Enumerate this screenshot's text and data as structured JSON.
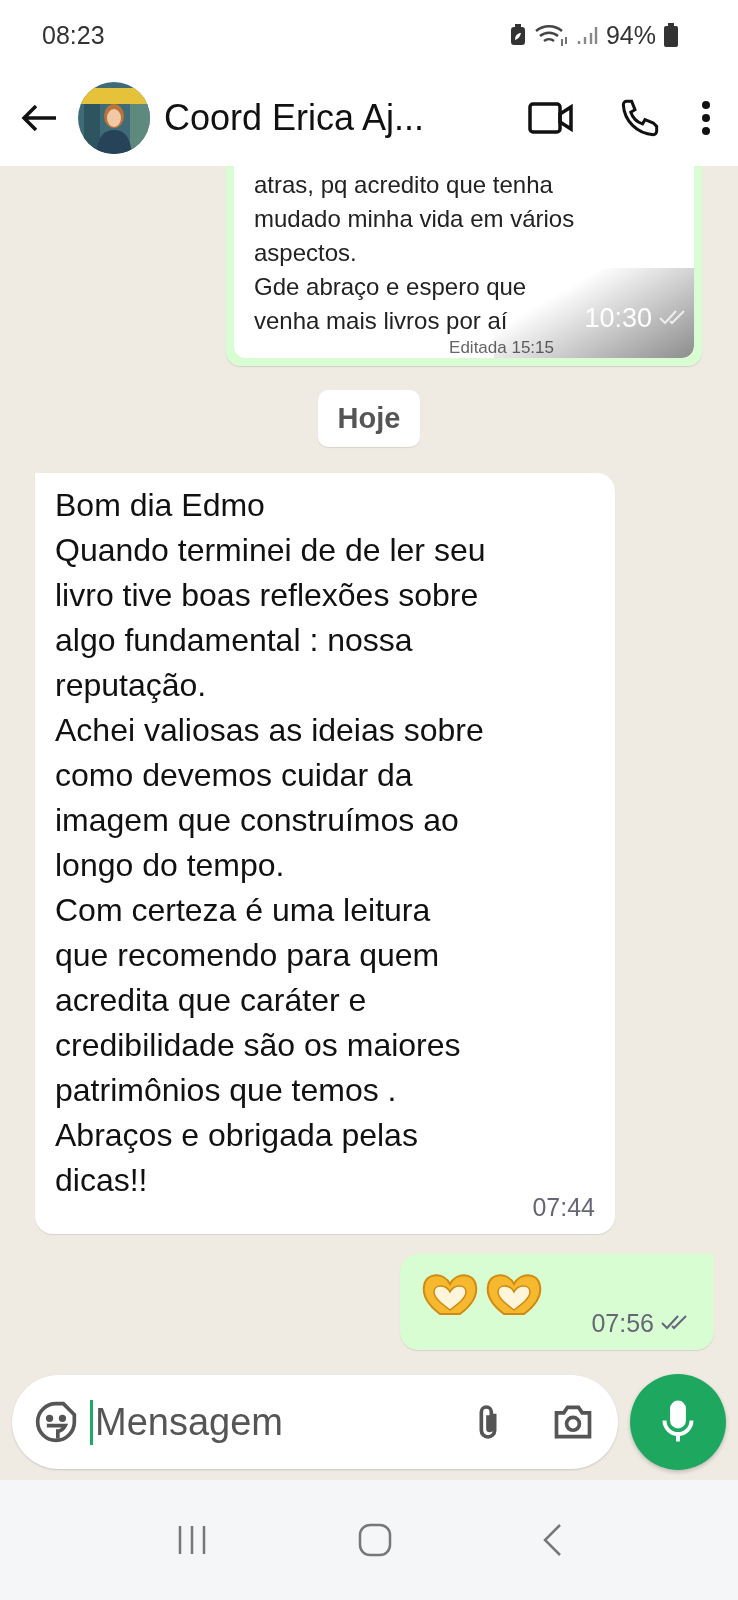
{
  "status_bar": {
    "time": "08:23",
    "battery": "94%"
  },
  "header": {
    "title": "Coord Erica Aj..."
  },
  "messages": [
    {
      "kind": "sent_image",
      "image_text": "atras, pq acredito que tenha\nmudado minha vida em vários\naspectos.\nGde abraço e espero que\nvenha mais livros por aí",
      "time": "10:30",
      "read": false,
      "edited": "Editada 15:15"
    },
    {
      "kind": "date",
      "label": "Hoje"
    },
    {
      "kind": "received_text",
      "text": "Bom dia Edmo\nQuando terminei de de ler seu\nlivro tive boas reflexões sobre\nalgo fundamental : nossa\nreputação.\nAchei valiosas as ideias sobre\ncomo devemos cuidar da\nimagem que construímos ao\nlongo do tempo.\nCom certeza é uma leitura\nque recomendo para quem\nacredita que caráter e\ncredibilidade são os maiores\npatrimônios que temos .\nAbraços e obrigada pelas\ndicas!!",
      "time": "07:44"
    },
    {
      "kind": "sent_stickers",
      "items": [
        {
          "kind": "heart_hands"
        },
        {
          "kind": "heart_hands"
        }
      ],
      "time": "07:56",
      "read": false
    }
  ],
  "composer": {
    "placeholder": "Mensagem"
  }
}
